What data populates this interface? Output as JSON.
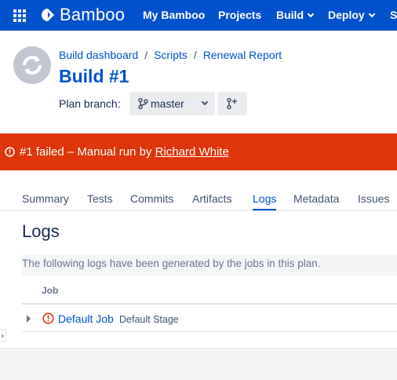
{
  "topnav": {
    "app_name": "Bamboo",
    "items": [
      {
        "label": "My Bamboo"
      },
      {
        "label": "Projects"
      },
      {
        "label": "Build"
      },
      {
        "label": "Deploy"
      },
      {
        "label": "S"
      }
    ],
    "background": "#0052cc"
  },
  "header": {
    "breadcrumbs": [
      "Build dashboard",
      "Scripts",
      "Renewal Report"
    ],
    "title": "Build #1",
    "plan_branch_label": "Plan branch:",
    "branch": "master"
  },
  "banner": {
    "message": "#1 failed – Manual run by ",
    "user": "Richard White",
    "color": "#de350b"
  },
  "tabs": [
    {
      "label": "Summary",
      "active": false
    },
    {
      "label": "Tests",
      "active": false
    },
    {
      "label": "Commits",
      "active": false
    },
    {
      "label": "Artifacts",
      "active": false
    },
    {
      "label": "Logs",
      "active": true
    },
    {
      "label": "Metadata",
      "active": false
    },
    {
      "label": "Issues",
      "active": false
    }
  ],
  "logs": {
    "heading": "Logs",
    "description": "The following logs have been generated by the jobs in this plan.",
    "column_job": "Job",
    "rows": [
      {
        "job": "Default Job",
        "stage": "Default Stage",
        "status": "failed"
      }
    ]
  }
}
